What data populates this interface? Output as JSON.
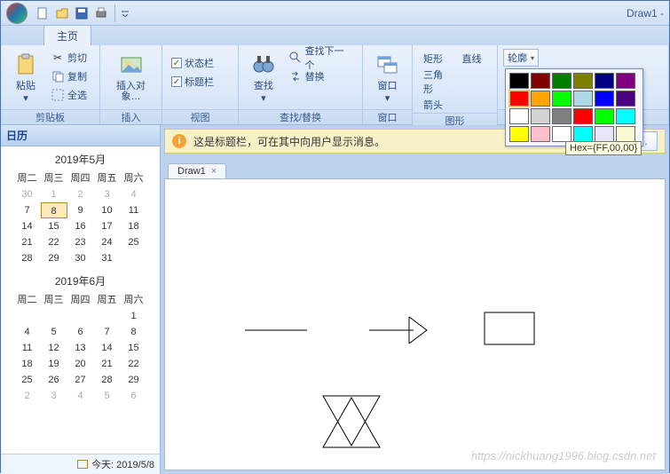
{
  "window": {
    "title": "Draw1 -"
  },
  "tabs": {
    "home": "主页"
  },
  "ribbon": {
    "clipboard": {
      "paste": "粘贴",
      "cut": "剪切",
      "copy": "复制",
      "selectAll": "全选",
      "group": "剪贴板"
    },
    "insert": {
      "insertObj": "插入对象…",
      "group": "插入"
    },
    "view": {
      "statusbar": "状态栏",
      "titlebar": "标题栏",
      "group": "视图"
    },
    "find": {
      "find": "查找",
      "findNext": "查找下一个",
      "replace": "替换",
      "group": "查找/替换"
    },
    "window": {
      "window": "窗口",
      "group": "窗口"
    },
    "shapes": {
      "rect": "矩形",
      "line": "直线",
      "tri": "三角形",
      "arrow": "箭头",
      "group": "图形"
    },
    "fill": {
      "label": "轮廓",
      "group": ""
    }
  },
  "colorPicker": {
    "colors": [
      "#000000",
      "#800000",
      "#008000",
      "#808000",
      "#000080",
      "#800080",
      "#ff0000",
      "#ffa500",
      "#00ff00",
      "#add8e6",
      "#0000ff",
      "#4b0082",
      "#ffffff",
      "#d3d3d3",
      "#808080",
      "#ff0000",
      "#00ff00",
      "#00ffff",
      "#ffff00",
      "#ffc0cb",
      "#ffffff",
      "#00ffff",
      "#e6e6fa",
      "#fafad2"
    ],
    "selected": 6,
    "tooltip": "Hex={FF,00,00}"
  },
  "sidebar": {
    "title": "日历"
  },
  "calendar": {
    "months": [
      {
        "title": "2019年5月",
        "headers": [
          "周二",
          "周三",
          "周四",
          "周五",
          "周六"
        ],
        "rows": [
          [
            "30",
            "1",
            "2",
            "3",
            "4"
          ],
          [
            "7",
            "8",
            "9",
            "10",
            "11"
          ],
          [
            "14",
            "15",
            "16",
            "17",
            "18"
          ],
          [
            "21",
            "22",
            "23",
            "24",
            "25"
          ],
          [
            "28",
            "29",
            "30",
            "31",
            ""
          ]
        ],
        "dim": [
          [
            0
          ]
        ],
        "today": [
          1,
          1
        ]
      },
      {
        "title": "2019年6月",
        "headers": [
          "周二",
          "周三",
          "周四",
          "周五",
          "周六"
        ],
        "rows": [
          [
            "",
            "",
            "",
            "",
            "1"
          ],
          [
            "4",
            "5",
            "6",
            "7",
            "8"
          ],
          [
            "11",
            "12",
            "13",
            "14",
            "15"
          ],
          [
            "18",
            "19",
            "20",
            "21",
            "22"
          ],
          [
            "25",
            "26",
            "27",
            "28",
            "29"
          ],
          [
            "2",
            "3",
            "4",
            "5",
            "6"
          ]
        ],
        "dim": [
          [
            5,
            0
          ],
          [
            5,
            1
          ],
          [
            5,
            2
          ],
          [
            5,
            3
          ],
          [
            5,
            4
          ]
        ]
      }
    ],
    "todayLabel": "今天: 2019/5/8"
  },
  "messageBar": {
    "text": "这是标题栏，可在其中向用户显示消息。",
    "options": "选项…"
  },
  "docTabs": [
    {
      "label": "Draw1"
    }
  ],
  "watermark": "https://nickhuang1996.blog.csdn.net"
}
